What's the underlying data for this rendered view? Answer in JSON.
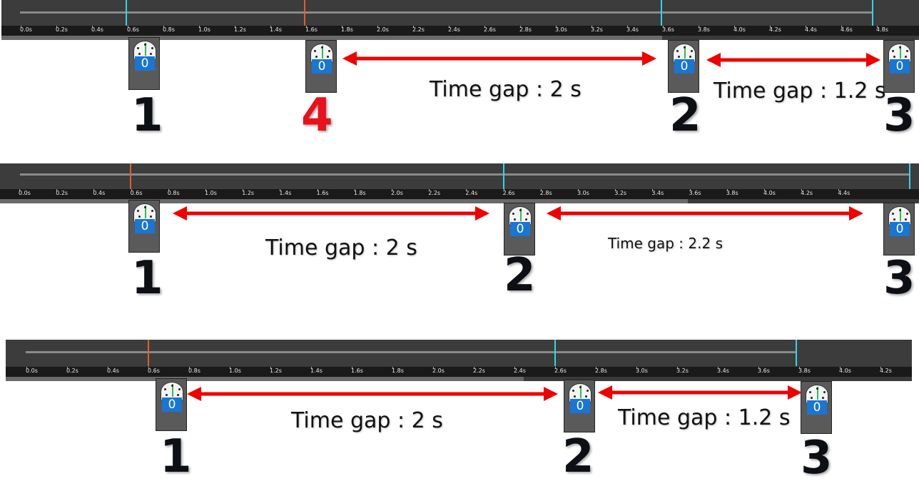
{
  "tick_labels": [
    "0.0s",
    "0.2s",
    "0.4s",
    "0.6s",
    "0.8s",
    "1.0s",
    "1.2s",
    "1.4s",
    "1.6s",
    "1.8s",
    "2.0s",
    "2.2s",
    "2.4s",
    "2.6s",
    "2.8s",
    "3.0s",
    "3.2s",
    "3.4s",
    "3.6s",
    "3.8s",
    "4.0s",
    "4.2s",
    "4.4s",
    "4.6s",
    "4.8s"
  ],
  "device_value": "0",
  "colors": {
    "marker_cyan": "#2fd6e6",
    "marker_orange": "#e0602a",
    "arrow_red": "#ee0000",
    "screen_blue": "#1976d2"
  },
  "icons": [
    "stopwatch-device-icon",
    "double-arrow-icon"
  ],
  "panel1": {
    "labels": {
      "n1": "1",
      "n4": "4",
      "n2": "2",
      "n3": "3"
    },
    "gap_a": "Time gap : 2 s",
    "gap_b": "Time gap : 1.2 s"
  },
  "panel2": {
    "labels": {
      "n1": "1",
      "n2": "2",
      "n3": "3"
    },
    "gap_a": "Time gap : 2 s",
    "gap_b": "Time gap : 2.2 s"
  },
  "panel3": {
    "labels": {
      "n1": "1",
      "n2": "2",
      "n3": "3"
    },
    "gap_a": "Time gap : 2 s",
    "gap_b": "Time gap : 1.2 s"
  }
}
